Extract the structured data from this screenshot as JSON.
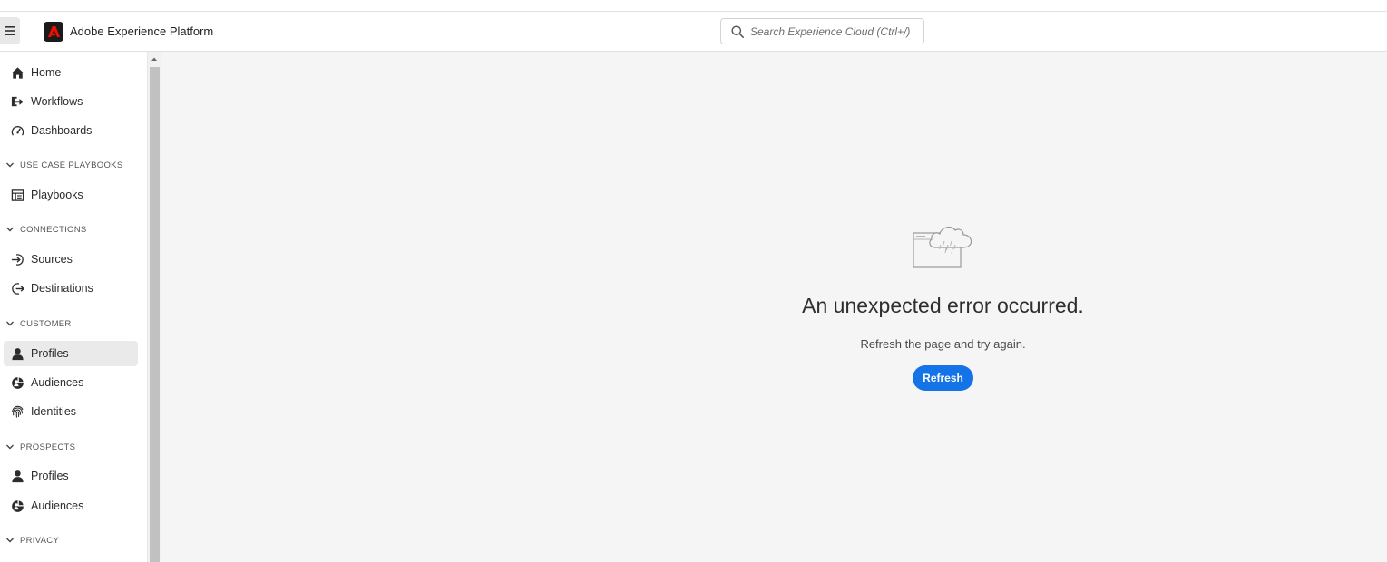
{
  "header": {
    "menu_icon": "hamburger-icon",
    "logo_icon": "adobe-logo-icon",
    "app_title": "Adobe Experience Platform",
    "search_placeholder": "Search Experience Cloud (Ctrl+/)",
    "brand_color": "#eb1000"
  },
  "sidebar": {
    "items": [
      {
        "type": "item",
        "label": "Home",
        "icon": "home-icon"
      },
      {
        "type": "item",
        "label": "Workflows",
        "icon": "workflows-icon"
      },
      {
        "type": "item",
        "label": "Dashboards",
        "icon": "dashboard-gauge-icon"
      },
      {
        "type": "section",
        "label": "USE CASE PLAYBOOKS"
      },
      {
        "type": "item",
        "label": "Playbooks",
        "icon": "playbooks-icon"
      },
      {
        "type": "section",
        "label": "CONNECTIONS"
      },
      {
        "type": "item",
        "label": "Sources",
        "icon": "sources-icon"
      },
      {
        "type": "item",
        "label": "Destinations",
        "icon": "destinations-icon"
      },
      {
        "type": "section",
        "label": "CUSTOMER"
      },
      {
        "type": "item",
        "label": "Profiles",
        "icon": "person-icon",
        "selected": true
      },
      {
        "type": "item",
        "label": "Audiences",
        "icon": "audiences-icon"
      },
      {
        "type": "item",
        "label": "Identities",
        "icon": "fingerprint-icon"
      },
      {
        "type": "section",
        "label": "PROSPECTS"
      },
      {
        "type": "item",
        "label": "Profiles",
        "icon": "person-icon"
      },
      {
        "type": "item",
        "label": "Audiences",
        "icon": "audiences-icon"
      },
      {
        "type": "section",
        "label": "PRIVACY"
      }
    ]
  },
  "main": {
    "illustration_icon": "cloud-rain-window-icon",
    "error_title": "An unexpected error occurred.",
    "error_description": "Refresh the page and try again.",
    "refresh_label": "Refresh",
    "accent_color": "#1473e6"
  }
}
